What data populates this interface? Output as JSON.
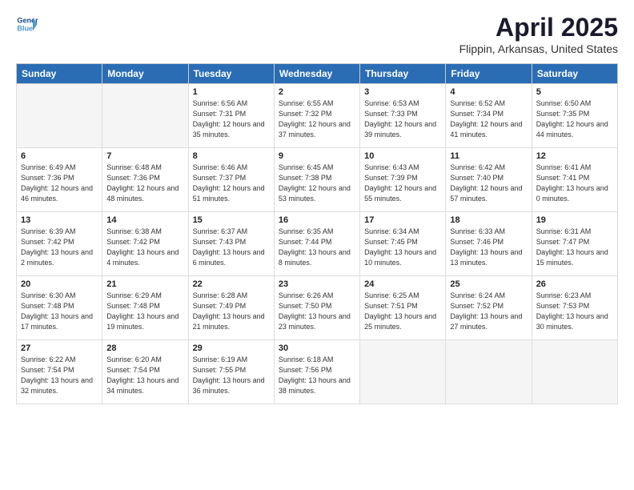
{
  "header": {
    "logo_line1": "General",
    "logo_line2": "Blue",
    "month_title": "April 2025",
    "location": "Flippin, Arkansas, United States"
  },
  "weekdays": [
    "Sunday",
    "Monday",
    "Tuesday",
    "Wednesday",
    "Thursday",
    "Friday",
    "Saturday"
  ],
  "weeks": [
    [
      {
        "day": "",
        "info": ""
      },
      {
        "day": "",
        "info": ""
      },
      {
        "day": "1",
        "info": "Sunrise: 6:56 AM\nSunset: 7:31 PM\nDaylight: 12 hours and 35 minutes."
      },
      {
        "day": "2",
        "info": "Sunrise: 6:55 AM\nSunset: 7:32 PM\nDaylight: 12 hours and 37 minutes."
      },
      {
        "day": "3",
        "info": "Sunrise: 6:53 AM\nSunset: 7:33 PM\nDaylight: 12 hours and 39 minutes."
      },
      {
        "day": "4",
        "info": "Sunrise: 6:52 AM\nSunset: 7:34 PM\nDaylight: 12 hours and 41 minutes."
      },
      {
        "day": "5",
        "info": "Sunrise: 6:50 AM\nSunset: 7:35 PM\nDaylight: 12 hours and 44 minutes."
      }
    ],
    [
      {
        "day": "6",
        "info": "Sunrise: 6:49 AM\nSunset: 7:36 PM\nDaylight: 12 hours and 46 minutes."
      },
      {
        "day": "7",
        "info": "Sunrise: 6:48 AM\nSunset: 7:36 PM\nDaylight: 12 hours and 48 minutes."
      },
      {
        "day": "8",
        "info": "Sunrise: 6:46 AM\nSunset: 7:37 PM\nDaylight: 12 hours and 51 minutes."
      },
      {
        "day": "9",
        "info": "Sunrise: 6:45 AM\nSunset: 7:38 PM\nDaylight: 12 hours and 53 minutes."
      },
      {
        "day": "10",
        "info": "Sunrise: 6:43 AM\nSunset: 7:39 PM\nDaylight: 12 hours and 55 minutes."
      },
      {
        "day": "11",
        "info": "Sunrise: 6:42 AM\nSunset: 7:40 PM\nDaylight: 12 hours and 57 minutes."
      },
      {
        "day": "12",
        "info": "Sunrise: 6:41 AM\nSunset: 7:41 PM\nDaylight: 13 hours and 0 minutes."
      }
    ],
    [
      {
        "day": "13",
        "info": "Sunrise: 6:39 AM\nSunset: 7:42 PM\nDaylight: 13 hours and 2 minutes."
      },
      {
        "day": "14",
        "info": "Sunrise: 6:38 AM\nSunset: 7:42 PM\nDaylight: 13 hours and 4 minutes."
      },
      {
        "day": "15",
        "info": "Sunrise: 6:37 AM\nSunset: 7:43 PM\nDaylight: 13 hours and 6 minutes."
      },
      {
        "day": "16",
        "info": "Sunrise: 6:35 AM\nSunset: 7:44 PM\nDaylight: 13 hours and 8 minutes."
      },
      {
        "day": "17",
        "info": "Sunrise: 6:34 AM\nSunset: 7:45 PM\nDaylight: 13 hours and 10 minutes."
      },
      {
        "day": "18",
        "info": "Sunrise: 6:33 AM\nSunset: 7:46 PM\nDaylight: 13 hours and 13 minutes."
      },
      {
        "day": "19",
        "info": "Sunrise: 6:31 AM\nSunset: 7:47 PM\nDaylight: 13 hours and 15 minutes."
      }
    ],
    [
      {
        "day": "20",
        "info": "Sunrise: 6:30 AM\nSunset: 7:48 PM\nDaylight: 13 hours and 17 minutes."
      },
      {
        "day": "21",
        "info": "Sunrise: 6:29 AM\nSunset: 7:48 PM\nDaylight: 13 hours and 19 minutes."
      },
      {
        "day": "22",
        "info": "Sunrise: 6:28 AM\nSunset: 7:49 PM\nDaylight: 13 hours and 21 minutes."
      },
      {
        "day": "23",
        "info": "Sunrise: 6:26 AM\nSunset: 7:50 PM\nDaylight: 13 hours and 23 minutes."
      },
      {
        "day": "24",
        "info": "Sunrise: 6:25 AM\nSunset: 7:51 PM\nDaylight: 13 hours and 25 minutes."
      },
      {
        "day": "25",
        "info": "Sunrise: 6:24 AM\nSunset: 7:52 PM\nDaylight: 13 hours and 27 minutes."
      },
      {
        "day": "26",
        "info": "Sunrise: 6:23 AM\nSunset: 7:53 PM\nDaylight: 13 hours and 30 minutes."
      }
    ],
    [
      {
        "day": "27",
        "info": "Sunrise: 6:22 AM\nSunset: 7:54 PM\nDaylight: 13 hours and 32 minutes."
      },
      {
        "day": "28",
        "info": "Sunrise: 6:20 AM\nSunset: 7:54 PM\nDaylight: 13 hours and 34 minutes."
      },
      {
        "day": "29",
        "info": "Sunrise: 6:19 AM\nSunset: 7:55 PM\nDaylight: 13 hours and 36 minutes."
      },
      {
        "day": "30",
        "info": "Sunrise: 6:18 AM\nSunset: 7:56 PM\nDaylight: 13 hours and 38 minutes."
      },
      {
        "day": "",
        "info": ""
      },
      {
        "day": "",
        "info": ""
      },
      {
        "day": "",
        "info": ""
      }
    ]
  ]
}
